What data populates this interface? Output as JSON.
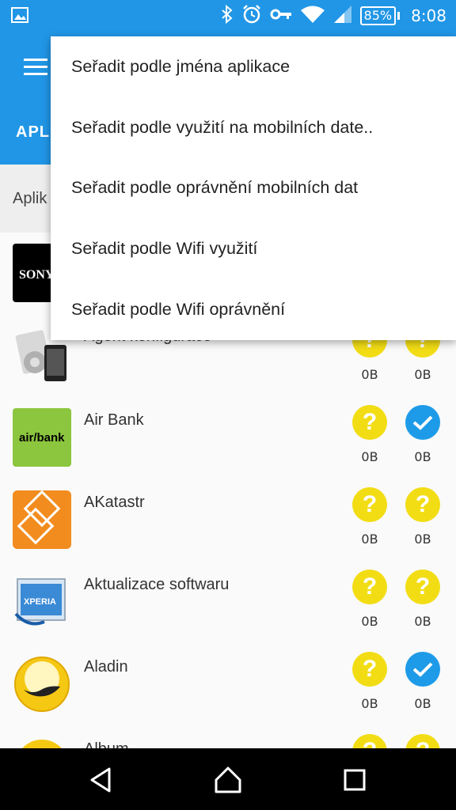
{
  "status_bar": {
    "battery": "85",
    "battery_unit": "%",
    "time": "8:08",
    "icons": [
      "image-icon",
      "bluetooth-icon",
      "alarm-icon",
      "key-icon",
      "wifi-icon",
      "signal-icon",
      "battery-icon"
    ]
  },
  "app_bar": {
    "tab_title": "APLI"
  },
  "list_header": {
    "label": "Aplik"
  },
  "menu": {
    "items": [
      "Seřadit podle jména aplikace",
      "Seřadit podle využití na mobilních date..",
      "Seřadit podle oprávnění mobilních dat",
      "Seřadit podle Wifi využití",
      "Seřadit podle Wifi oprávnění"
    ]
  },
  "apps": [
    {
      "name": "",
      "icon": "sony-logo",
      "logo_text": "SONY",
      "mobile_status": "unknown",
      "mobile_size": "",
      "wifi_status": "unknown",
      "wifi_size": ""
    },
    {
      "name": "Agent konfigurace",
      "icon": "settings-phone-icon",
      "mobile_status": "unknown",
      "mobile_size": "0B",
      "wifi_status": "unknown",
      "wifi_size": "0B"
    },
    {
      "name": "Air Bank",
      "icon": "airbank-logo",
      "logo_text": "air/bank",
      "mobile_status": "unknown",
      "mobile_size": "0B",
      "wifi_status": "allowed",
      "wifi_size": "0B"
    },
    {
      "name": "AKatastr",
      "icon": "akatastr-icon",
      "mobile_status": "unknown",
      "mobile_size": "0B",
      "wifi_status": "unknown",
      "wifi_size": "0B"
    },
    {
      "name": "Aktualizace softwaru",
      "icon": "xperia-update-icon",
      "logo_text": "XPERIA",
      "mobile_status": "unknown",
      "mobile_size": "0B",
      "wifi_status": "unknown",
      "wifi_size": "0B"
    },
    {
      "name": "Aladin",
      "icon": "lamp-icon",
      "mobile_status": "allowed",
      "mobile_size": "0B",
      "wifi_status": "allowed",
      "wifi_size": "0B"
    },
    {
      "name": "Album",
      "icon": "album-icon",
      "mobile_status": "unknown",
      "mobile_size": "",
      "wifi_status": "unknown",
      "wifi_size": ""
    }
  ],
  "colors": {
    "primary": "#2196e6",
    "unknown": "#f2dd15",
    "allowed": "#1e9be8"
  },
  "nav_bar": {
    "icons": [
      "back-icon",
      "home-icon",
      "recents-icon"
    ]
  }
}
